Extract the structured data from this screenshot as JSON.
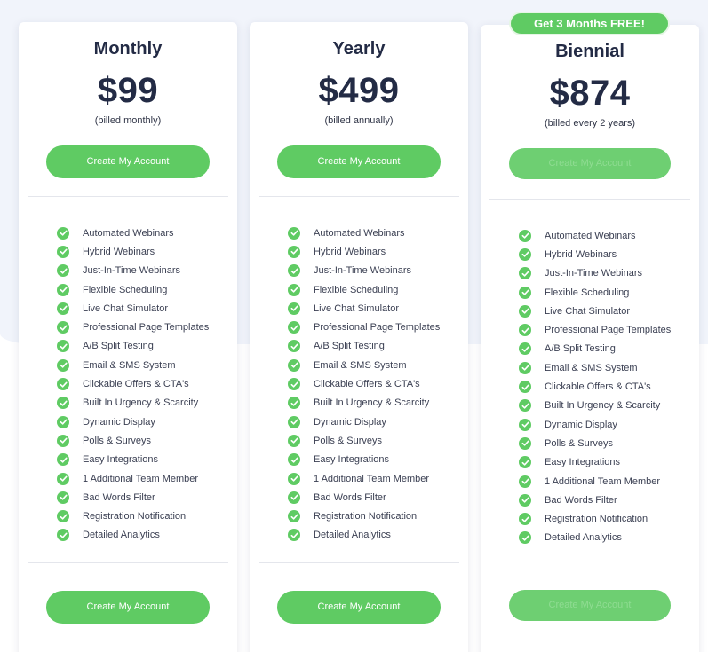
{
  "badge": {
    "label": "Get 3 Months FREE!"
  },
  "plans": [
    {
      "name": "Monthly",
      "price": "$99",
      "billing": "(billed monthly)",
      "cta_top": "Create My Account",
      "cta_bottom": "Create My Account"
    },
    {
      "name": "Yearly",
      "price": "$499",
      "billing": "(billed annually)",
      "cta_top": "Create My Account",
      "cta_bottom": "Create My Account"
    },
    {
      "name": "Biennial",
      "price": "$874",
      "billing": "(billed every 2 years)",
      "cta_top": "Create My Account",
      "cta_bottom": "Create My Account"
    }
  ],
  "features": [
    "Automated Webinars",
    "Hybrid Webinars",
    "Just-In-Time Webinars",
    "Flexible Scheduling",
    "Live Chat Simulator",
    "Professional Page Templates",
    "A/B Split Testing",
    "Email & SMS System",
    "Clickable Offers & CTA's",
    "Built In Urgency & Scarcity",
    "Dynamic Display",
    "Polls & Surveys",
    "Easy Integrations",
    "1 Additional Team Member",
    "Bad Words Filter",
    "Registration Notification",
    "Detailed Analytics"
  ],
  "icons": {
    "feature_check": "check-circle-icon"
  },
  "colors": {
    "accent_green": "#5fcb63",
    "heading_navy": "#232b45",
    "background_band": "#f1f4fb"
  }
}
